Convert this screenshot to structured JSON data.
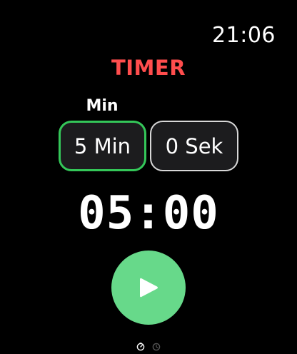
{
  "status_bar": {
    "time": "21:06"
  },
  "screen": {
    "title": "TIMER",
    "title_color": "#ff4d4d"
  },
  "picker": {
    "focused_label": "Min",
    "minutes": {
      "value": "5 Min",
      "focused": true,
      "border_color": "#34c759"
    },
    "seconds": {
      "value": "0 Sek",
      "focused": false
    }
  },
  "countdown": {
    "display": "05:00"
  },
  "play_button": {
    "icon": "play-icon",
    "color": "#67d98a"
  },
  "pager": {
    "pages": [
      {
        "icon": "timer-icon",
        "active": true
      },
      {
        "icon": "clock-icon",
        "active": false
      }
    ]
  }
}
